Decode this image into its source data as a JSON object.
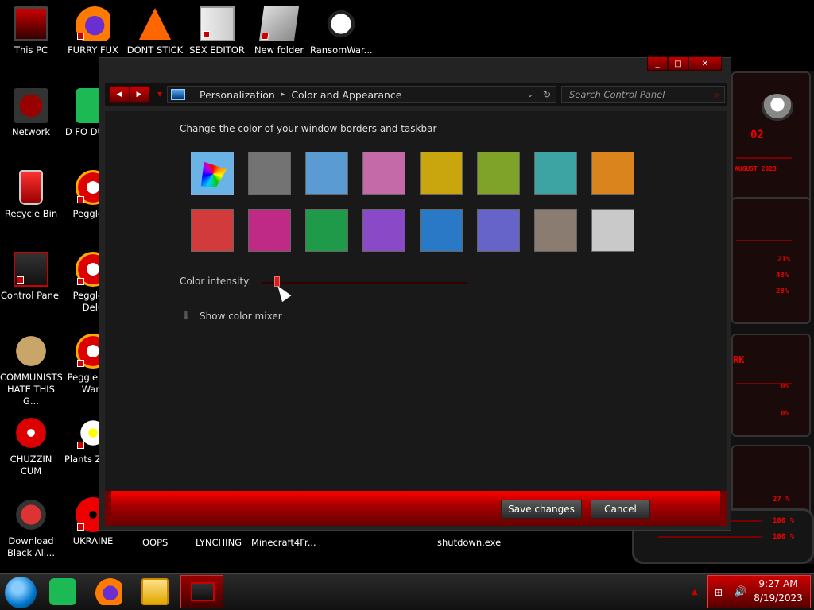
{
  "desktop": {
    "icons": [
      {
        "label": "This PC"
      },
      {
        "label": "FURRY FUX"
      },
      {
        "label": "DONT STICK"
      },
      {
        "label": "SEX EDITOR"
      },
      {
        "label": "New folder"
      },
      {
        "label": "RansomWar..."
      },
      {
        "label": "Network"
      },
      {
        "label": "D FO DUMBI"
      },
      {
        "label": "Recycle Bin"
      },
      {
        "label": "Peggle D"
      },
      {
        "label": "Control Panel"
      },
      {
        "label": "Peggle N Delu"
      },
      {
        "label": "COMMUNISTS HATE THIS G..."
      },
      {
        "label": "Peggle V of Warc"
      },
      {
        "label": "CHUZZIN CUM"
      },
      {
        "label": "Plants Zomb"
      },
      {
        "label": "Download Black Ali..."
      },
      {
        "label": "UKRAINE"
      },
      {
        "label": "OOPS"
      },
      {
        "label": "LYNCHING"
      },
      {
        "label": "Minecraft4Fr..."
      },
      {
        "label": "shutdown.exe"
      }
    ]
  },
  "widget": {
    "texts": [
      "02",
      "AUGUST 2023",
      "21%",
      "43%",
      "28%",
      "RK",
      "0%",
      "0%",
      "27 %",
      "100 %",
      "100 %"
    ]
  },
  "window": {
    "title_buttons": {
      "minimize": "_",
      "maximize": "□",
      "close": "✕"
    },
    "nav": {
      "back": "◀",
      "forward": "▶"
    },
    "breadcrumb": [
      "Personalization",
      "Color and Appearance"
    ],
    "search_placeholder": "Search Control Panel",
    "heading": "Change the color of your window borders and taskbar",
    "swatches": [
      {
        "name": "automatic",
        "color": "#69b3e6",
        "selected": true
      },
      {
        "name": "gray",
        "color": "#737373"
      },
      {
        "name": "sky",
        "color": "#5a9bd3"
      },
      {
        "name": "pink",
        "color": "#c46aa8"
      },
      {
        "name": "gold",
        "color": "#c9a60e"
      },
      {
        "name": "lime",
        "color": "#7ea328"
      },
      {
        "name": "teal",
        "color": "#3ea3a3"
      },
      {
        "name": "orange",
        "color": "#d9841d"
      },
      {
        "name": "red",
        "color": "#d23b3b"
      },
      {
        "name": "magenta",
        "color": "#c02a87"
      },
      {
        "name": "green",
        "color": "#1e9a49"
      },
      {
        "name": "violet",
        "color": "#8a4ac7"
      },
      {
        "name": "blue",
        "color": "#2a79c7"
      },
      {
        "name": "periwinkle",
        "color": "#6663c9"
      },
      {
        "name": "taupe",
        "color": "#8a7c70"
      },
      {
        "name": "silver",
        "color": "#c9c9c9"
      }
    ],
    "intensity_label": "Color intensity:",
    "intensity_value": 0.07,
    "mixer_label": "Show color mixer",
    "save_label": "Save changes",
    "cancel_label": "Cancel"
  },
  "taskbar": {
    "time": "9:27 AM",
    "date": "8/19/2023"
  }
}
